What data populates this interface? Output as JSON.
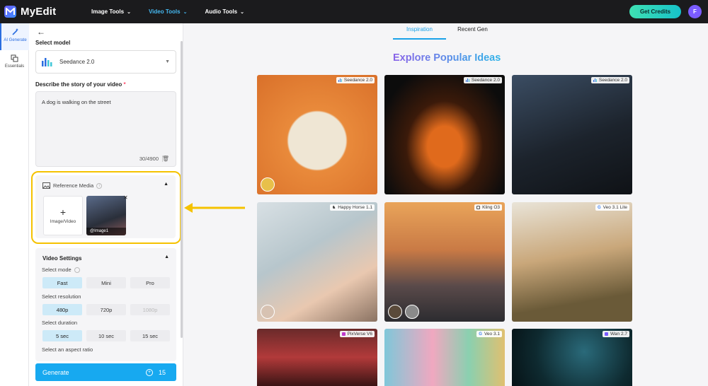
{
  "app": {
    "name": "MyEdit"
  },
  "nav": [
    {
      "label": "Image Tools",
      "active": false
    },
    {
      "label": "Video Tools",
      "active": true
    },
    {
      "label": "Audio Tools",
      "active": false
    }
  ],
  "header": {
    "credits_label": "Get Credits",
    "avatar_initial": "F"
  },
  "rail": [
    {
      "label": "AI Generate",
      "icon": "magic-wand-icon",
      "active": true
    },
    {
      "label": "Essentials",
      "icon": "layers-icon",
      "active": false
    }
  ],
  "panel": {
    "select_model_label": "Select model",
    "model_name": "Seedance 2.0",
    "story_label": "Describe the story of your video",
    "required_mark": "*",
    "story_text": "A dog is walking on the street",
    "char_count": "30/4900",
    "reference_media_label": "Reference Media",
    "add_media_label": "Image/Video",
    "reference_item_label": "@Image1",
    "video_settings_label": "Video Settings",
    "select_mode_label": "Select mode",
    "modes": [
      "Fast",
      "Mini",
      "Pro"
    ],
    "select_resolution_label": "Select resolution",
    "resolutions": [
      "480p",
      "720p",
      "1080p"
    ],
    "select_duration_label": "Select duration",
    "durations": [
      "5 sec",
      "10 sec",
      "15 sec"
    ],
    "aspect_ratio_label": "Select an aspect ratio",
    "generate_label": "Generate",
    "generate_cost": "15"
  },
  "gallery": {
    "tabs": [
      "Inspiration",
      "Recent Gen"
    ],
    "active_tab": "Inspiration",
    "heading": "Explore Popular Ideas",
    "cards": [
      {
        "model": "Seedance 2.0",
        "icon": "bars-icon"
      },
      {
        "model": "Seedance 2.0",
        "icon": "bars-icon"
      },
      {
        "model": "Seedance 2.0",
        "icon": "bars-icon"
      },
      {
        "model": "Happy Horse 1.1",
        "icon": "horse-icon"
      },
      {
        "model": "Kling O3",
        "icon": "kling-icon"
      },
      {
        "model": "Veo 3.1 Lite",
        "icon": "google-icon"
      },
      {
        "model": "PixVerse V6",
        "icon": "pixverse-icon"
      },
      {
        "model": "Veo 3.1",
        "icon": "google-icon"
      },
      {
        "model": "Wan 2.7",
        "icon": "wan-icon"
      }
    ]
  },
  "colors": {
    "accent": "#17a9f0",
    "highlight": "#f5c200",
    "topbar": "#1b1b1d"
  }
}
